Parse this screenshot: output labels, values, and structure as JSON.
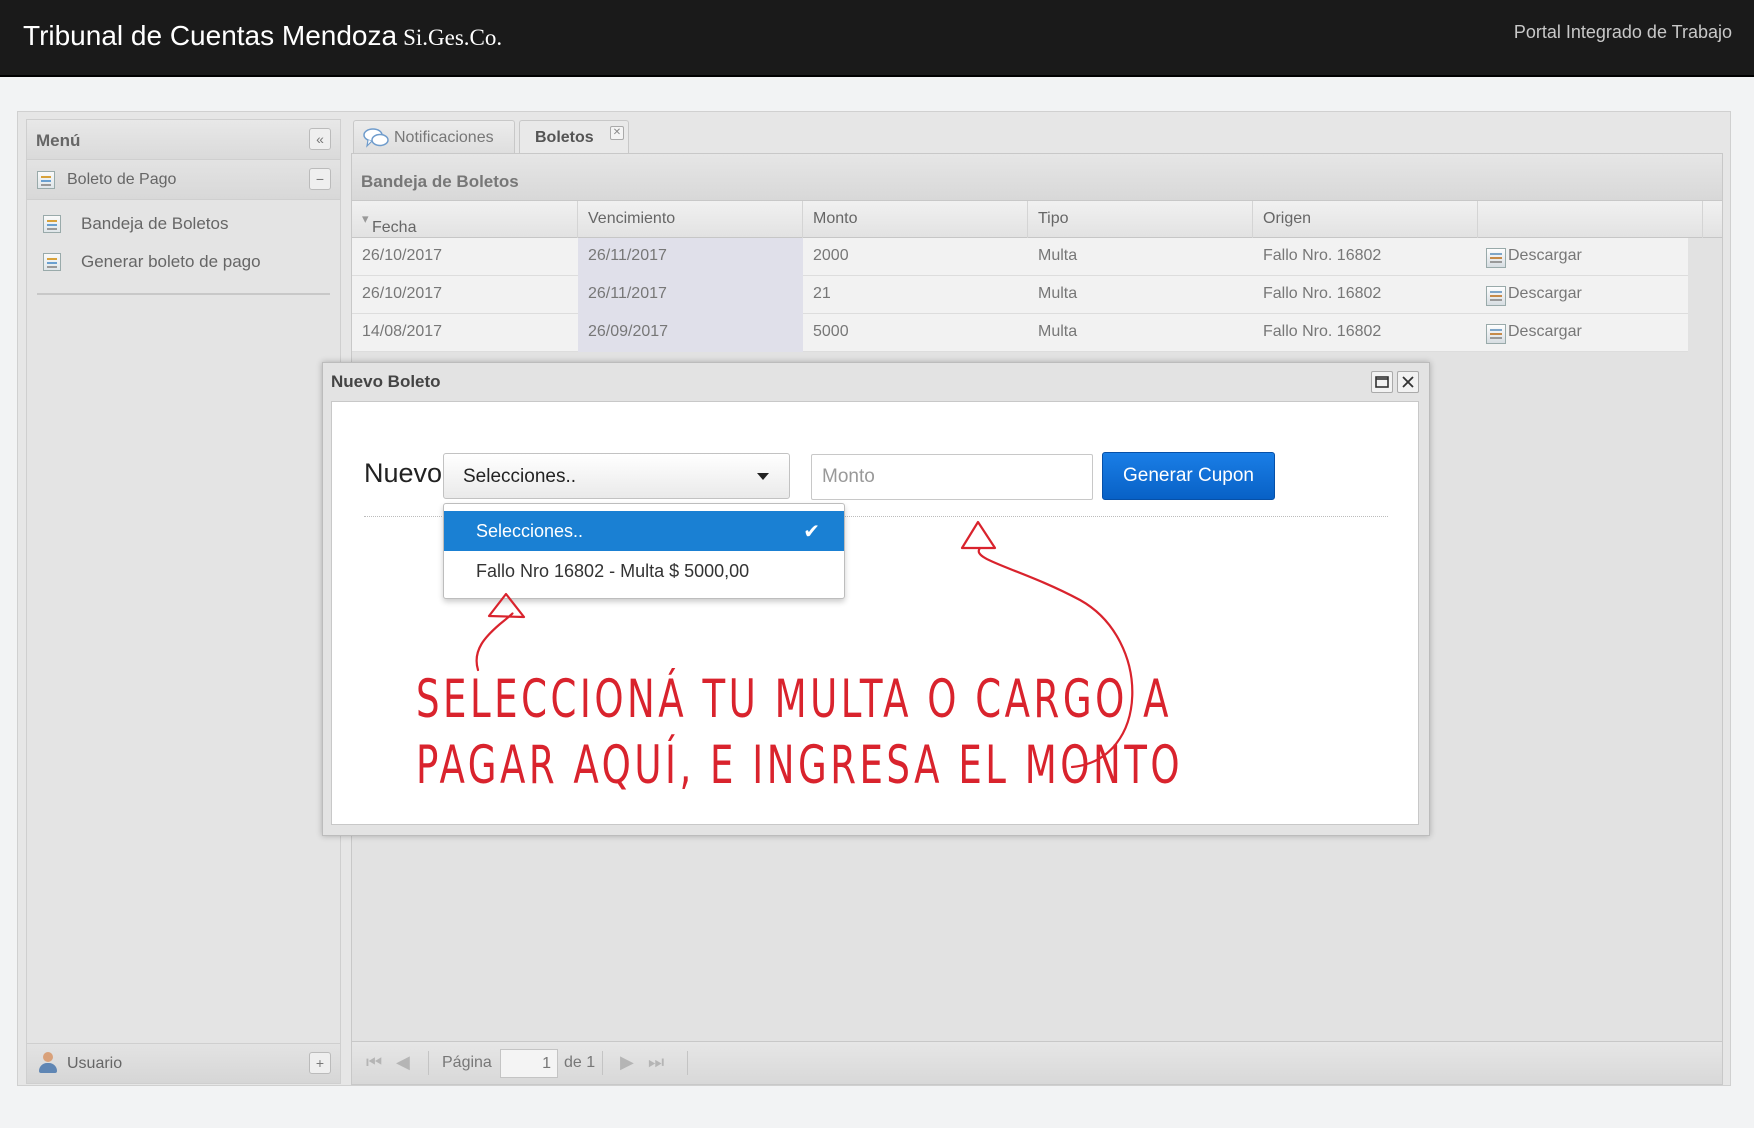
{
  "header": {
    "title": "Tribunal de Cuentas Mendoza",
    "subtitle": "Si.Ges.Co.",
    "portal": "Portal Integrado de Trabajo"
  },
  "sidebar": {
    "title": "Menú",
    "section": "Boleto de Pago",
    "items": [
      {
        "label": "Bandeja de Boletos",
        "icon": "list-icon"
      },
      {
        "label": "Generar boleto de pago",
        "icon": "add-document-icon"
      }
    ],
    "footer": "Usuario"
  },
  "tabs": [
    {
      "label": "Notificaciones",
      "icon": "chat-bubbles-icon"
    },
    {
      "label": "Boletos",
      "active": true
    }
  ],
  "grid": {
    "title": "Bandeja de Boletos",
    "columns": [
      "Fecha",
      "Vencimiento",
      "Monto",
      "Tipo",
      "Origen"
    ],
    "sort_indicator": "▾",
    "rows": [
      {
        "fecha": "26/10/2017",
        "vencimiento": "26/11/2017",
        "monto": "2000",
        "tipo": "Multa",
        "origen": "Fallo Nro. 16802",
        "accion": "Descargar"
      },
      {
        "fecha": "26/10/2017",
        "vencimiento": "26/11/2017",
        "monto": "21",
        "tipo": "Multa",
        "origen": "Fallo Nro. 16802",
        "accion": "Descargar"
      },
      {
        "fecha": "14/08/2017",
        "vencimiento": "26/09/2017",
        "monto": "5000",
        "tipo": "Multa",
        "origen": "Fallo Nro. 16802",
        "accion": "Descargar"
      }
    ]
  },
  "pager": {
    "page_label": "Página",
    "page": "1",
    "of_label": "de 1"
  },
  "dialog": {
    "title": "Nuevo Boleto",
    "nuevo_label": "Nuevo",
    "select_value": "Selecciones..",
    "monto_placeholder": "Monto",
    "button": "Generar Cupon",
    "options": [
      "Selecciones..",
      "Fallo Nro 16802 - Multa $ 5000,00"
    ]
  },
  "annotation": {
    "line1": "SELECCIONÁ TU MULTA O CARGO A",
    "line2": "PAGAR AQUÍ, E INGRESA EL MONTO",
    "color": "#d9232d"
  },
  "colors": {
    "topbar": "#1a1a1a",
    "accent": "#1a80d3",
    "button": "#0861c6"
  }
}
